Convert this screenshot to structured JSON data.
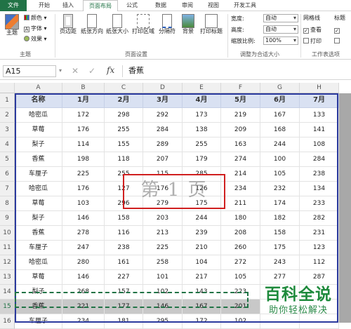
{
  "tabs": [
    "文件",
    "开始",
    "插入",
    "页面布局",
    "公式",
    "数据",
    "审阅",
    "视图",
    "开发工具"
  ],
  "ribbon": {
    "theme_group": {
      "theme_label": "主题",
      "colors_label": "颜色",
      "fonts_label": "字体",
      "effects_label": "效果",
      "group_label": "主题"
    },
    "page_setup_group": {
      "margins_label": "页边距",
      "orientation_label": "纸张方向",
      "size_label": "纸张大小",
      "print_area_label": "打印区域",
      "breaks_label": "分隔符",
      "background_label": "背景",
      "print_titles_label": "打印标题",
      "group_label": "页面设置"
    },
    "scale_group": {
      "width_label": "宽度:",
      "width_value": "自动",
      "height_label": "高度:",
      "height_value": "自动",
      "scale_label": "缩放比例:",
      "scale_value": "100%",
      "group_label": "调整为合适大小"
    },
    "sheet_options_group": {
      "gridlines_label": "网格线",
      "headings_label": "标题",
      "view_label": "查看",
      "print_label": "打印",
      "view2_label": "查看",
      "print2_label": "打印",
      "group_label": "工作表选项"
    }
  },
  "formula_bar": {
    "name_box": "A15",
    "cancel_icon": "✕",
    "enter_icon": "✓",
    "fx_label": "fx",
    "content": "香蕉"
  },
  "columns": [
    "A",
    "B",
    "C",
    "D",
    "E",
    "F",
    "G",
    "H"
  ],
  "rows": [
    {
      "num": "1",
      "cells": [
        "名称",
        "1月",
        "2月",
        "3月",
        "4月",
        "5月",
        "6月",
        "7月"
      ]
    },
    {
      "num": "2",
      "cells": [
        "哈密瓜",
        "172",
        "298",
        "292",
        "173",
        "219",
        "167",
        "133"
      ]
    },
    {
      "num": "3",
      "cells": [
        "草莓",
        "176",
        "255",
        "284",
        "138",
        "209",
        "168",
        "141"
      ]
    },
    {
      "num": "4",
      "cells": [
        "梨子",
        "114",
        "155",
        "289",
        "255",
        "163",
        "244",
        "108"
      ]
    },
    {
      "num": "5",
      "cells": [
        "香蕉",
        "198",
        "118",
        "207",
        "179",
        "274",
        "100",
        "284"
      ]
    },
    {
      "num": "6",
      "cells": [
        "车厘子",
        "225",
        "255",
        "115",
        "285",
        "214",
        "105",
        "238"
      ]
    },
    {
      "num": "7",
      "cells": [
        "哈密瓜",
        "176",
        "127",
        "176",
        "126",
        "234",
        "232",
        "134"
      ]
    },
    {
      "num": "8",
      "cells": [
        "草莓",
        "103",
        "296",
        "279",
        "175",
        "211",
        "174",
        "233"
      ]
    },
    {
      "num": "9",
      "cells": [
        "梨子",
        "146",
        "158",
        "203",
        "244",
        "180",
        "182",
        "282"
      ]
    },
    {
      "num": "10",
      "cells": [
        "香蕉",
        "278",
        "116",
        "213",
        "239",
        "208",
        "158",
        "231"
      ]
    },
    {
      "num": "11",
      "cells": [
        "车厘子",
        "247",
        "238",
        "225",
        "210",
        "260",
        "175",
        "123"
      ]
    },
    {
      "num": "12",
      "cells": [
        "哈密瓜",
        "280",
        "161",
        "258",
        "104",
        "272",
        "243",
        "112"
      ]
    },
    {
      "num": "13",
      "cells": [
        "草莓",
        "146",
        "227",
        "101",
        "217",
        "105",
        "277",
        "287"
      ]
    },
    {
      "num": "14",
      "cells": [
        "梨子",
        "268",
        "157",
        "102",
        "143",
        "223",
        "",
        ""
      ]
    },
    {
      "num": "15",
      "cells": [
        "香蕉",
        "221",
        "177",
        "146",
        "167",
        "201",
        "",
        ""
      ]
    },
    {
      "num": "16",
      "cells": [
        "车厘子",
        "234",
        "181",
        "295",
        "172",
        "102",
        "",
        ""
      ]
    }
  ],
  "page_watermark": "第 1 页",
  "logo": {
    "line1": "百科全说",
    "line2": "助你轻松解决"
  }
}
